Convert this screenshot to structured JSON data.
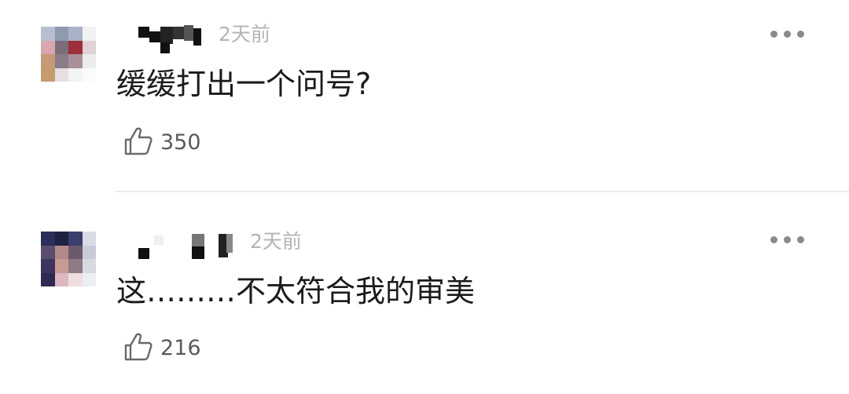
{
  "comments": [
    {
      "username": "▆▞▆",
      "time": "2天前",
      "text": "缓缓打出一个问号?",
      "likes": "350",
      "avatar_colors": [
        "#b8bed0",
        "#8f9aae",
        "#aab2c8",
        "#f2f2f2",
        "#d8a7b0",
        "#7b6d7a",
        "#9b2f3a",
        "#e0d2d6",
        "#c49a78",
        "#8a7c88",
        "#a98f98",
        "#ececec",
        "#c79a6f",
        "#e6dfe2",
        "#f3f3f3",
        "#fbfbfb"
      ]
    },
    {
      "username": "▪ ▌▐",
      "time": "2天前",
      "text": "这………不太符合我的审美",
      "likes": "216",
      "avatar_colors": [
        "#2b2e58",
        "#1e2242",
        "#3b3f6e",
        "#d9dce6",
        "#5a4e6e",
        "#b08a8a",
        "#6b5a6a",
        "#c9ccd8",
        "#3d3560",
        "#c89a92",
        "#8e7a82",
        "#d8dae2",
        "#2f2a52",
        "#dcb8c0",
        "#f0dde2",
        "#eceef2"
      ]
    }
  ],
  "icons": {
    "more": "more-dots-icon",
    "like": "thumbs-up-icon"
  },
  "colors": {
    "text": "#1b1b1b",
    "time": "#b4b4b4",
    "count": "#5a5a5a",
    "divider": "#ebebeb"
  }
}
